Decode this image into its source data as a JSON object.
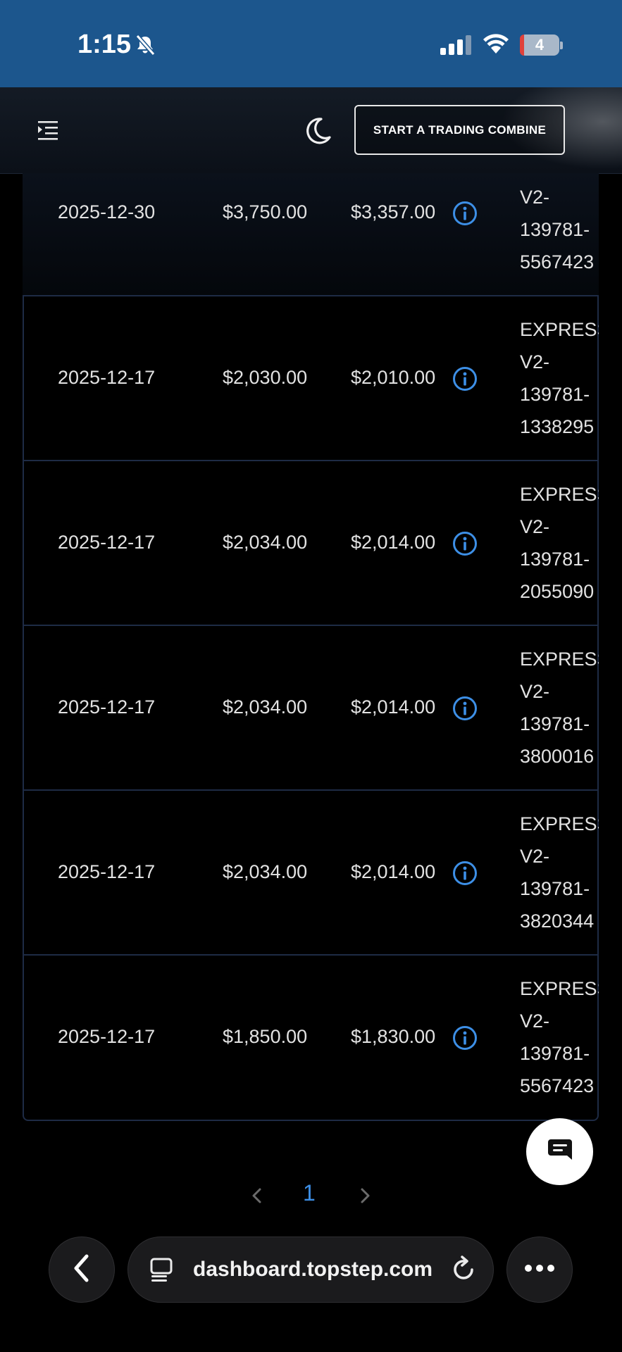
{
  "status_bar": {
    "time": "1:15",
    "battery_level": "4",
    "icons": [
      "bell-slash-icon",
      "cellular-signal-icon",
      "wifi-icon",
      "battery-icon"
    ]
  },
  "header": {
    "menu_icon": "menu-indent-icon",
    "theme_icon": "moon-icon",
    "cta_label": "START A TRADING COMBINE"
  },
  "table": {
    "rows": [
      {
        "date": "2025-12-30",
        "amount": "$3,750.00",
        "net": "$3,357.00",
        "account": [
          "V2-",
          "139781-",
          "5567423"
        ]
      },
      {
        "date": "2025-12-17",
        "amount": "$2,030.00",
        "net": "$2,010.00",
        "account": [
          "EXPRESS",
          "V2-",
          "139781-",
          "1338295"
        ]
      },
      {
        "date": "2025-12-17",
        "amount": "$2,034.00",
        "net": "$2,014.00",
        "account": [
          "EXPRESS",
          "V2-",
          "139781-",
          "2055090"
        ]
      },
      {
        "date": "2025-12-17",
        "amount": "$2,034.00",
        "net": "$2,014.00",
        "account": [
          "EXPRESS",
          "V2-",
          "139781-",
          "3800016"
        ]
      },
      {
        "date": "2025-12-17",
        "amount": "$2,034.00",
        "net": "$2,014.00",
        "account": [
          "EXPRESS",
          "V2-",
          "139781-",
          "3820344"
        ]
      },
      {
        "date": "2025-12-17",
        "amount": "$1,850.00",
        "net": "$1,830.00",
        "account": [
          "EXPRESS",
          "V2-",
          "139781-",
          "5567423"
        ]
      }
    ]
  },
  "pagination": {
    "current_page": "1"
  },
  "browser": {
    "url": "dashboard.topstep.com"
  },
  "colors": {
    "status_bar_bg": "#1c568d",
    "accent_blue": "#3d8fe6",
    "row_border": "#1e2b45"
  }
}
